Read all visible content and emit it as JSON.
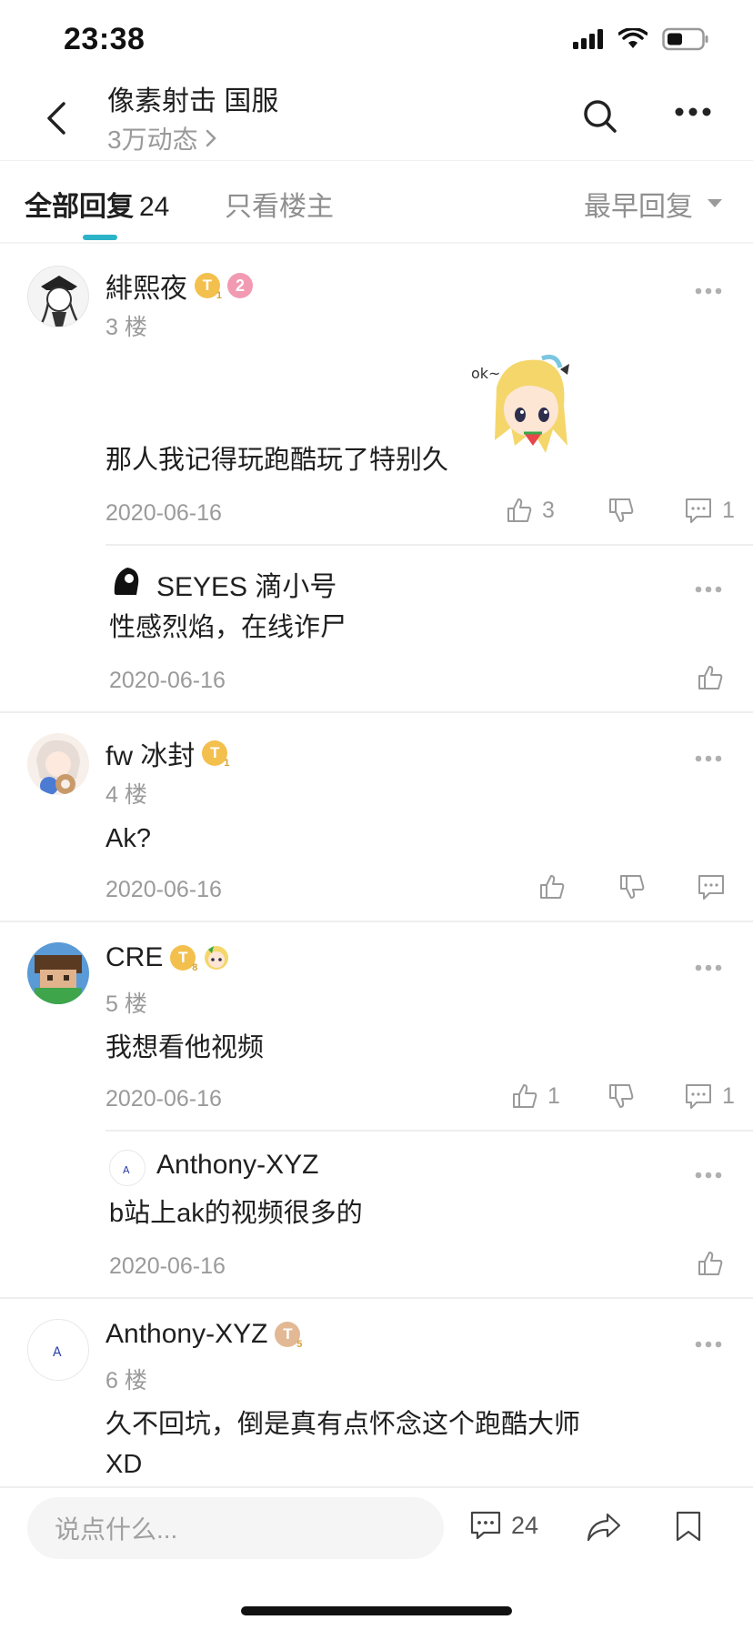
{
  "status": {
    "time": "23:38"
  },
  "nav": {
    "title": "像素射击 国服",
    "subtitle": "3万动态"
  },
  "tabs": {
    "all_label": "全部回复",
    "all_count": "24",
    "owner_label": "只看楼主",
    "sort_label": "最早回复"
  },
  "comments": [
    {
      "name": "緋熙夜",
      "floor": "3 楼",
      "text": "那人我记得玩跑酷玩了特别久",
      "date": "2020-06-16",
      "likes": "3",
      "replies": "1",
      "sub": {
        "name": "SEYES 滴小号",
        "text": "性感烈焰，在线诈尸",
        "date": "2020-06-16"
      }
    },
    {
      "name": "fw 冰封",
      "floor": "4 楼",
      "text": "Ak?",
      "date": "2020-06-16"
    },
    {
      "name": "CRE",
      "floor": "5 楼",
      "text": "我想看他视频",
      "date": "2020-06-16",
      "likes": "1",
      "replies": "1",
      "sub": {
        "name": "Anthony-XYZ",
        "text": "b站上ak的视频很多的",
        "date": "2020-06-16"
      }
    },
    {
      "name": "Anthony-XYZ",
      "floor": "6 楼",
      "text_line1": "久不回坑，倒是真有点怀念这个跑酷大师",
      "text_line2": "XD"
    }
  ],
  "bottom": {
    "placeholder": "说点什么...",
    "comment_count": "24"
  },
  "colors": {
    "accent": "#2bb3c7",
    "gold_badge": "#f3c04e",
    "pink_badge": "#f29ab2",
    "muted_text": "#9a9a9a"
  },
  "icons": [
    "back-icon",
    "search-icon",
    "more-icon",
    "like-icon",
    "dislike-icon",
    "comment-icon",
    "share-icon",
    "bookmark-icon"
  ]
}
